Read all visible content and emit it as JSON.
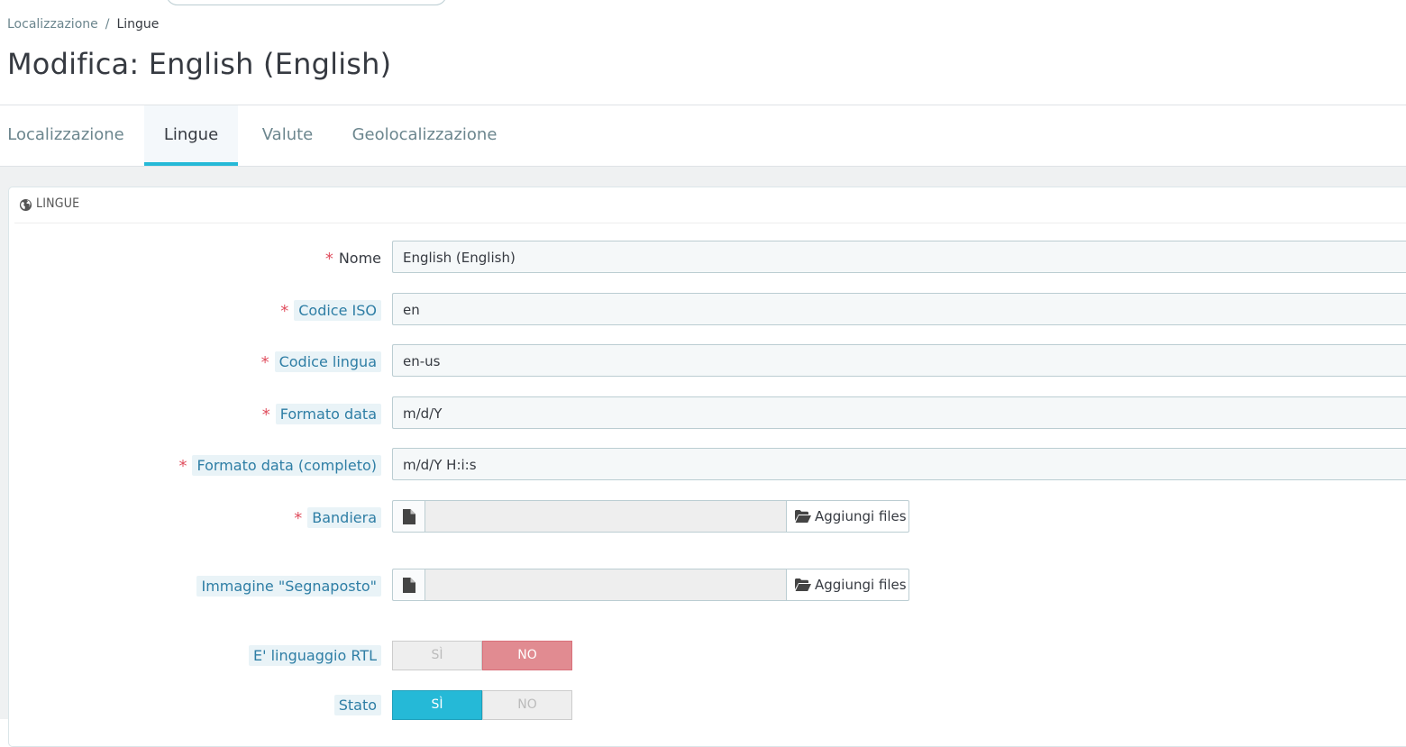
{
  "breadcrumb": {
    "parent": "Localizzazione",
    "separator": "/",
    "current": "Lingue"
  },
  "page_title": "Modifica: English (English)",
  "tabs": [
    {
      "label": "Localizzazione",
      "active": false
    },
    {
      "label": "Lingue",
      "active": true
    },
    {
      "label": "Valute",
      "active": false
    },
    {
      "label": "Geolocalizzazione",
      "active": false
    }
  ],
  "panel": {
    "heading": "LINGUE",
    "heading_icon": "globe-icon"
  },
  "form": {
    "nome": {
      "label": "Nome",
      "value": "English (English)",
      "required": true
    },
    "codice_iso": {
      "label": "Codice ISO",
      "value": "en",
      "required": true
    },
    "codice_lingua": {
      "label": "Codice lingua",
      "value": "en-us",
      "required": true
    },
    "formato_data": {
      "label": "Formato data",
      "value": "m/d/Y",
      "required": true
    },
    "formato_data_completo": {
      "label": "Formato data (completo)",
      "value": "m/d/Y H:i:s",
      "required": true
    },
    "bandiera": {
      "label": "Bandiera",
      "button": "Aggiungi files",
      "required": true
    },
    "segnaposto": {
      "label": "Immagine \"Segnaposto\"",
      "button": "Aggiungi files",
      "required": false
    },
    "rtl": {
      "label": "E' linguaggio RTL",
      "yes": "SÌ",
      "no": "NO",
      "selected": "NO"
    },
    "stato": {
      "label": "Stato",
      "yes": "SÌ",
      "no": "NO",
      "selected": "SÌ"
    }
  },
  "required_mark": "*",
  "colors": {
    "accent": "#25b9d7",
    "danger_switch": "#e18b91",
    "required": "#e04f5f"
  }
}
